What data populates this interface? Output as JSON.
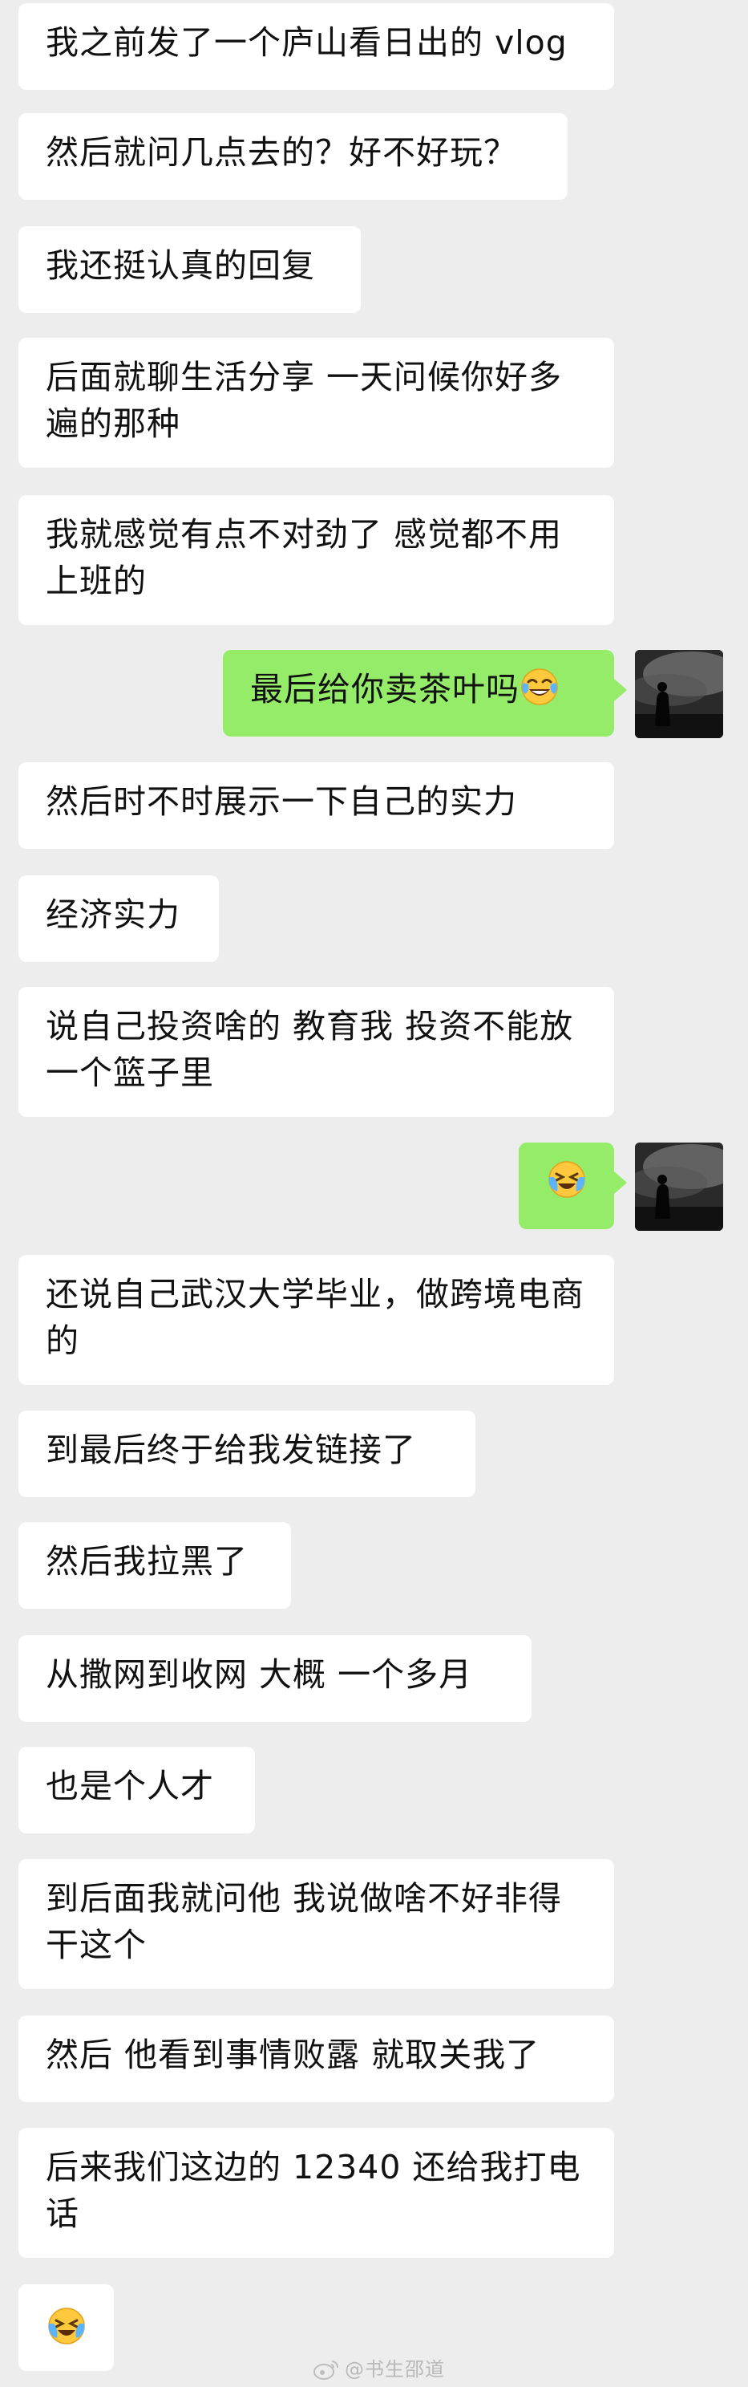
{
  "messages": [
    {
      "side": "in",
      "text": "我之前发了一个庐山看日出的 vlog"
    },
    {
      "side": "in",
      "text": "然后就问几点去的？好不好玩？"
    },
    {
      "side": "in",
      "text": "我还挺认真的回复"
    },
    {
      "side": "in",
      "text": "后面就聊生活分享 一天问候你好多遍的那种"
    },
    {
      "side": "in",
      "text": "我就感觉有点不对劲了 感觉都不用上班的"
    },
    {
      "side": "out",
      "text": "最后给你卖茶叶吗",
      "emoji": "tears-of-joy"
    },
    {
      "side": "in",
      "text": "然后时不时展示一下自己的实力"
    },
    {
      "side": "in",
      "text": "经济实力"
    },
    {
      "side": "in",
      "text": "说自己投资啥的 教育我 投资不能放一个篮子里"
    },
    {
      "side": "out",
      "text": "",
      "emoji": "crying-laughing"
    },
    {
      "side": "in",
      "text": "还说自己武汉大学毕业，做跨境电商的"
    },
    {
      "side": "in",
      "text": "到最后终于给我发链接了"
    },
    {
      "side": "in",
      "text": "然后我拉黑了"
    },
    {
      "side": "in",
      "text": "从撒网到收网 大概 一个多月"
    },
    {
      "side": "in",
      "text": "也是个人才"
    },
    {
      "side": "in",
      "text": "到后面我就问他  我说做啥不好非得干这个"
    },
    {
      "side": "in",
      "text": "然后 他看到事情败露 就取关我了"
    },
    {
      "side": "in",
      "text": "后来我们这边的 12340 还给我打电话"
    },
    {
      "side": "in",
      "text": "",
      "emoji": "crying-laughing"
    }
  ],
  "watermark": {
    "text": "@书生邵道",
    "icon": "weibo-icon"
  },
  "colors": {
    "background": "#ededed",
    "bubble_in": "#ffffff",
    "bubble_out": "#95ec69"
  }
}
